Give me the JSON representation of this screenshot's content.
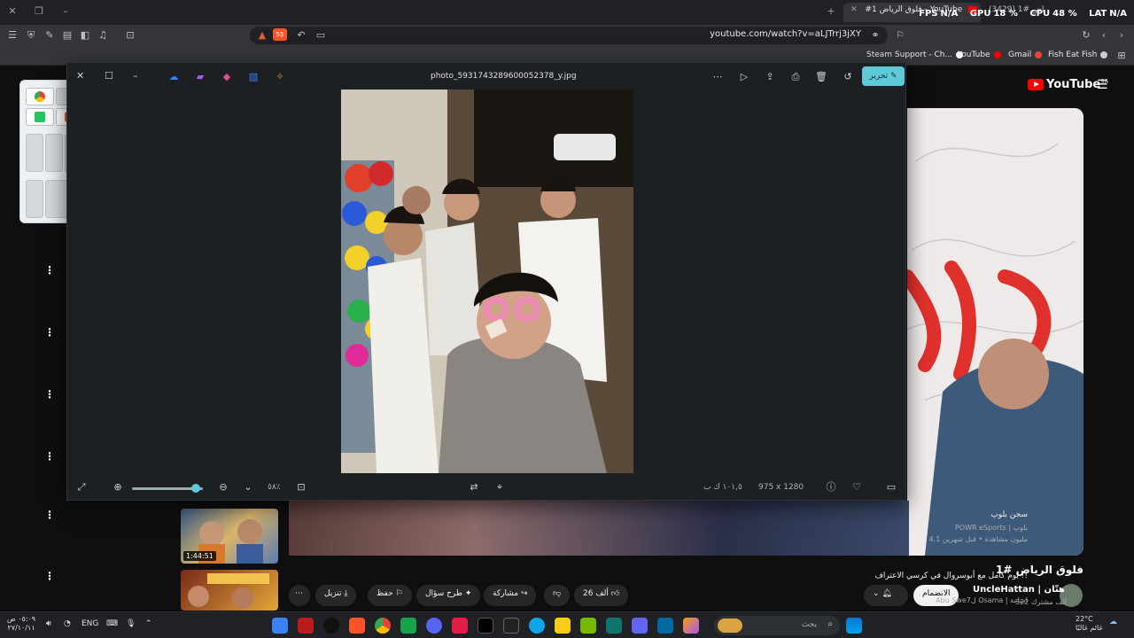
{
  "browser": {
    "tabs": [
      {
        "label": "#1 فلوق الرياض - YouTube",
        "badge": "(3429)"
      },
      {
        "label": "(3429) فلوق الرياض #1 - YouTube"
      }
    ],
    "url": "youtube.com/watch?v=aLJTrrj3jXY",
    "brave_shield_count": "55",
    "overlay": {
      "fps_label": "FPS",
      "fps_value": "N/A",
      "gpu_label": "GPU",
      "gpu_value": "18 %",
      "cpu_label": "CPU",
      "cpu_value": "48 %",
      "lat_label": "LAT",
      "lat_value": "N/A"
    },
    "bookmarks": [
      {
        "label": "Steam Support - Ch...",
        "color": "#ffffff"
      },
      {
        "label": "YouTube",
        "color": "#ff0000"
      },
      {
        "label": "Gmail",
        "color": "#ea4335"
      },
      {
        "label": "Fish Eat Fish",
        "color": "#cccccc"
      }
    ]
  },
  "youtube": {
    "logo": "YouTube",
    "logo_region": "SA",
    "video_title": "فلوق الرياض #1",
    "channel": {
      "name": "UncleHattan | هتّان",
      "subs": "322 ألف مشترك",
      "subscribe_label": "الانضمام"
    },
    "actions": {
      "likes": "26 ألف",
      "share": "مشاركة",
      "ask": "طرح سؤال",
      "save": "حفظ",
      "download": "تنزيل"
    },
    "recommendations": [
      {
        "title": "سجن بلوپ",
        "meta1": "POWR eSports | بلوپ",
        "meta2": "4.1 مليون مشاهدة • قبل شهرين",
        "duration": "1:44:51"
      },
      {
        "title": "يوم كامل مع أبوسروال في كرسي الاعتراف !!",
        "meta1": "Abu Swe7ل Osama | اسامة",
        "meta2": "",
        "duration": ""
      }
    ]
  },
  "photo_viewer": {
    "filename": "photo_5931743289600052378_y.jpg",
    "edit_label": "تحرير",
    "zoom_label": "٥٨٪",
    "file_size": "١٠١,٥ ك ب",
    "dimensions": "975 x 1280",
    "zoom_fraction": 0.9
  },
  "taskbar": {
    "search_placeholder": "بحث",
    "weather_temp": "22°C",
    "weather_text": "غائم غالبًا",
    "lang": "ENG",
    "time": "٠٥:٠٩ ص",
    "date": "٢٧/١٠/١١"
  }
}
